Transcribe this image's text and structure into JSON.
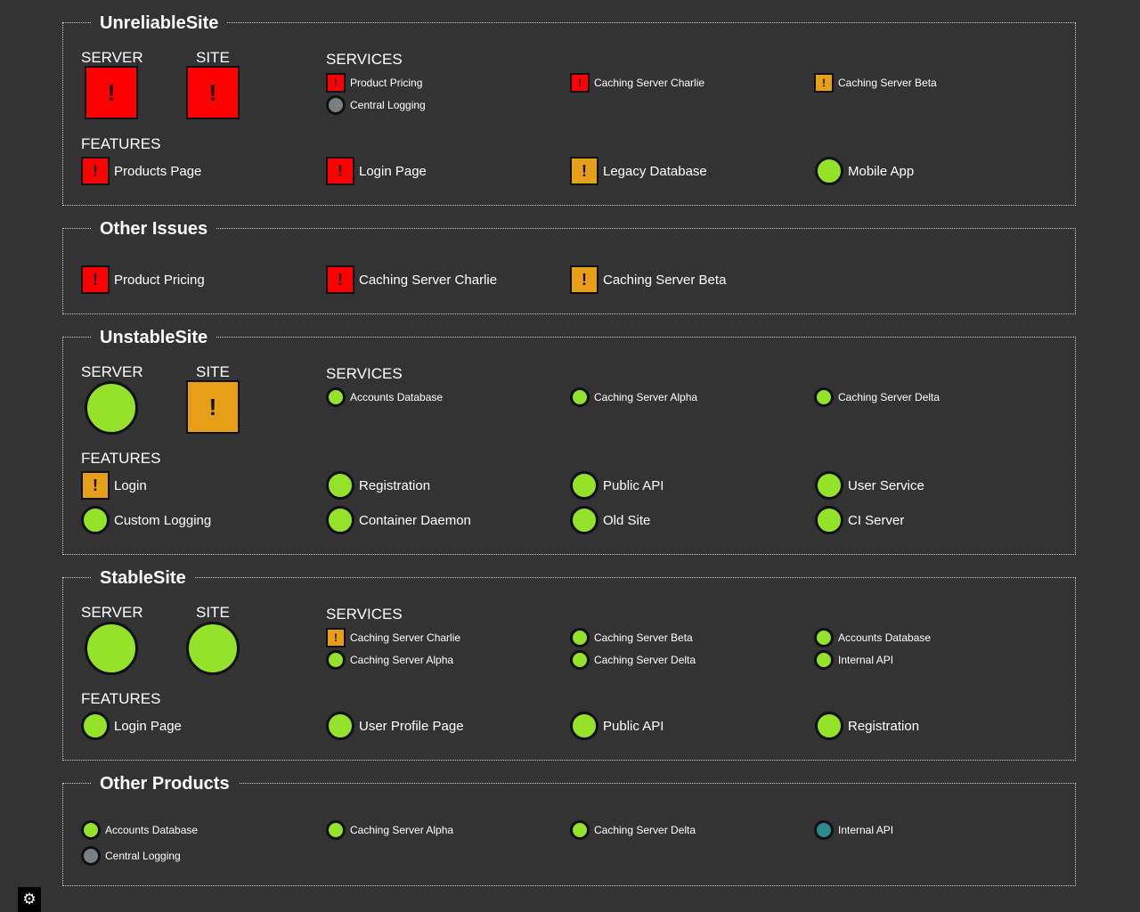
{
  "colors": {
    "critical": "#ff0000",
    "warning": "#e69f17",
    "ok": "#94e22a",
    "unknown": "#787f85",
    "info": "#2a8b8f",
    "background": "#333333"
  },
  "labels": {
    "server": "SERVER",
    "site": "SITE",
    "services": "SERVICES",
    "features": "FEATURES",
    "alert_glyph": "!"
  },
  "settings": {
    "icon": "gear-icon",
    "glyph": "⚙"
  },
  "unreliable": {
    "title": "UnreliableSite",
    "server_status": "critical",
    "site_status": "critical",
    "services": [
      {
        "label": "Product Pricing",
        "status": "critical"
      },
      {
        "label": "Caching Server Charlie",
        "status": "critical"
      },
      {
        "label": "Caching Server Beta",
        "status": "warning"
      },
      {
        "label": "Central Logging",
        "status": "unknown"
      }
    ],
    "features": [
      {
        "label": "Products Page",
        "status": "critical"
      },
      {
        "label": "Login Page",
        "status": "critical"
      },
      {
        "label": "Legacy Database",
        "status": "warning"
      },
      {
        "label": "Mobile App",
        "status": "ok"
      }
    ]
  },
  "other_issues": {
    "title": "Other Issues",
    "items": [
      {
        "label": "Product Pricing",
        "status": "critical"
      },
      {
        "label": "Caching Server Charlie",
        "status": "critical"
      },
      {
        "label": "Caching Server Beta",
        "status": "warning"
      }
    ]
  },
  "unstable": {
    "title": "UnstableSite",
    "server_status": "ok",
    "site_status": "warning",
    "services": [
      {
        "label": "Accounts Database",
        "status": "ok"
      },
      {
        "label": "Caching Server Alpha",
        "status": "ok"
      },
      {
        "label": "Caching Server Delta",
        "status": "ok"
      }
    ],
    "features": [
      {
        "label": "Login",
        "status": "warning"
      },
      {
        "label": "Registration",
        "status": "ok"
      },
      {
        "label": "Public API",
        "status": "ok"
      },
      {
        "label": "User Service",
        "status": "ok"
      },
      {
        "label": "Custom Logging",
        "status": "ok"
      },
      {
        "label": "Container Daemon",
        "status": "ok"
      },
      {
        "label": "Old Site",
        "status": "ok"
      },
      {
        "label": "CI Server",
        "status": "ok"
      }
    ]
  },
  "stable": {
    "title": "StableSite",
    "server_status": "ok",
    "site_status": "ok",
    "services": [
      {
        "label": "Caching Server Charlie",
        "status": "warning"
      },
      {
        "label": "Caching Server Beta",
        "status": "ok"
      },
      {
        "label": "Accounts Database",
        "status": "ok"
      },
      {
        "label": "Caching Server Alpha",
        "status": "ok"
      },
      {
        "label": "Caching Server Delta",
        "status": "ok"
      },
      {
        "label": "Internal API",
        "status": "ok"
      }
    ],
    "features": [
      {
        "label": "Login Page",
        "status": "ok"
      },
      {
        "label": "User Profile Page",
        "status": "ok"
      },
      {
        "label": "Public API",
        "status": "ok"
      },
      {
        "label": "Registration",
        "status": "ok"
      }
    ]
  },
  "other_products": {
    "title": "Other Products",
    "items": [
      {
        "label": "Accounts Database",
        "status": "ok"
      },
      {
        "label": "Caching Server Alpha",
        "status": "ok"
      },
      {
        "label": "Caching Server Delta",
        "status": "ok"
      },
      {
        "label": "Internal API",
        "status": "info"
      },
      {
        "label": "Central Logging",
        "status": "unknown"
      }
    ]
  }
}
